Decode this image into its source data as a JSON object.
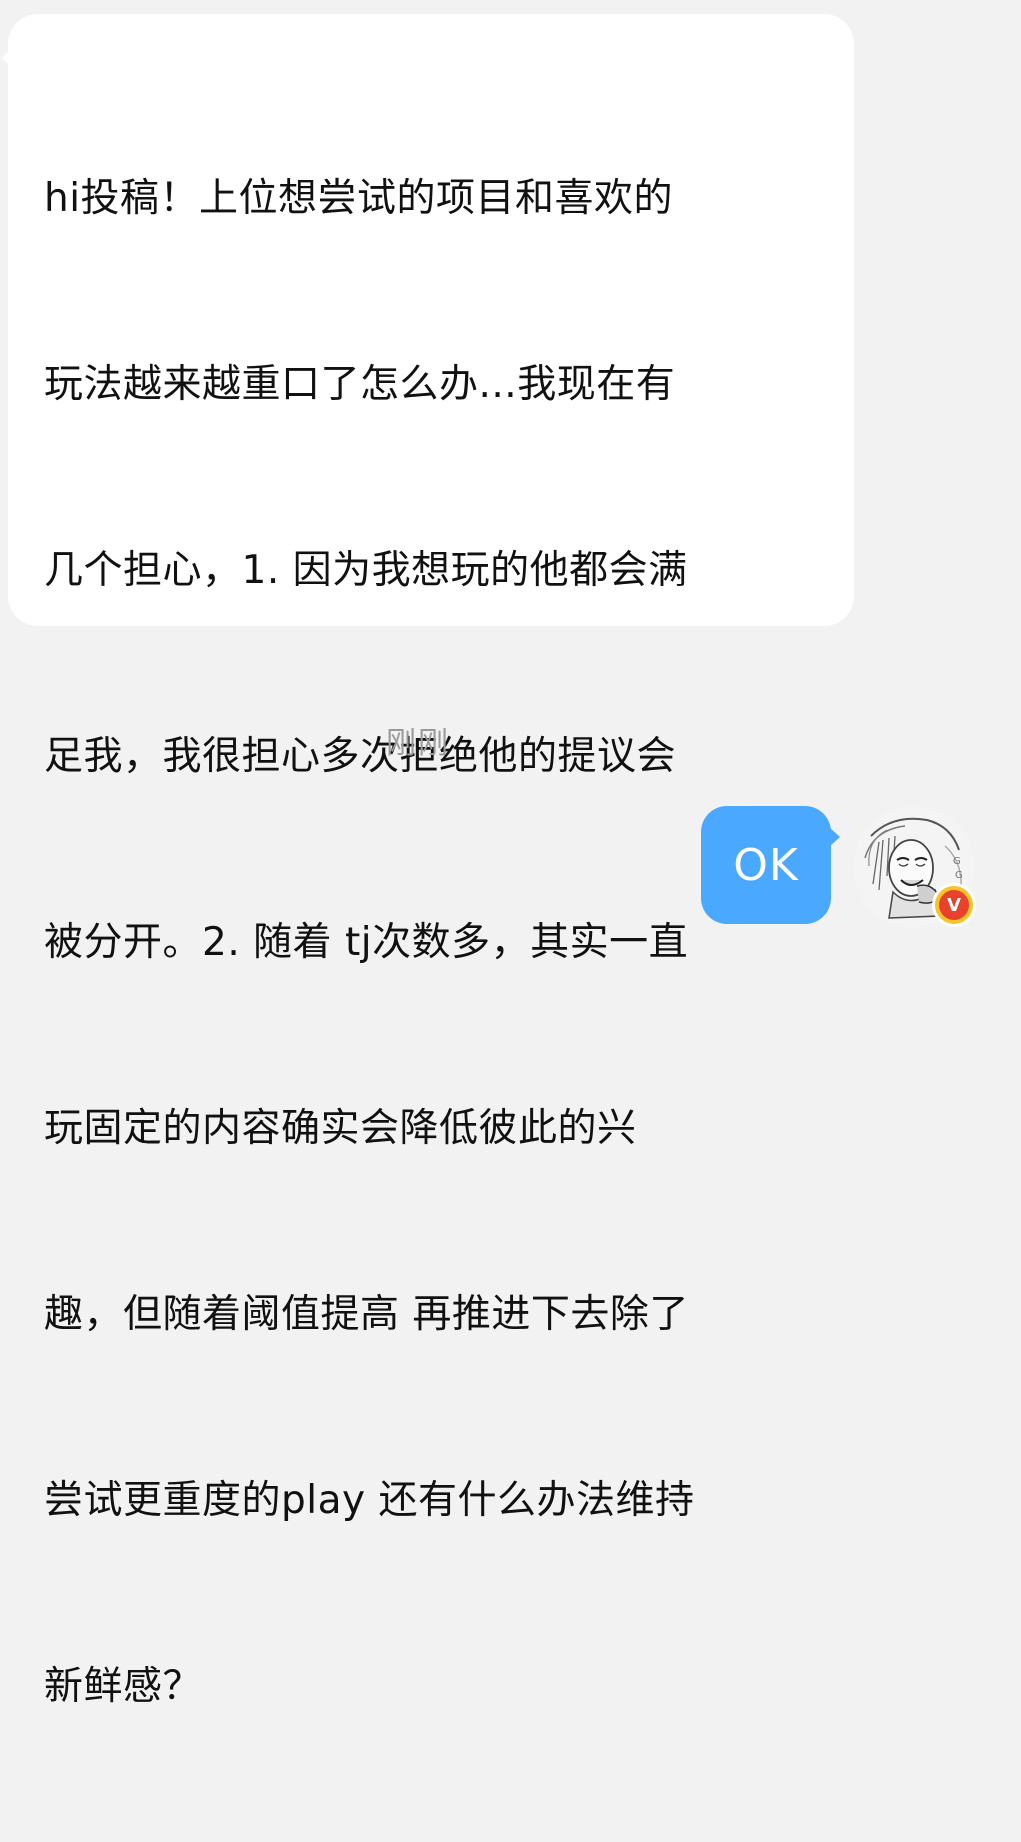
{
  "messages": {
    "incoming": {
      "lines": [
        "hi投稿！上位想尝试的项目和喜欢的",
        "玩法越来越重口了怎么办...我现在有",
        "几个担心，1. 因为我想玩的他都会满",
        "足我，我很担心多次拒绝他的提议会",
        "被分开。2. 随着 tj次数多，其实一直",
        "玩固定的内容确实会降低彼此的兴",
        "趣，但随着阈值提高 再推进下去除了",
        "尝试更重度的play 还有什么办法维持",
        "新鲜感？"
      ]
    },
    "timestamp": "刚刚",
    "outgoing": {
      "text": "OK"
    }
  },
  "avatar": {
    "icon": "user-avatar-manga",
    "badge_icon": "verified-v-badge",
    "badge_text": "V",
    "badge_color": "#f7c52b",
    "badge_inner_color": "#e8412c"
  },
  "colors": {
    "background": "#f2f2f2",
    "incoming_bubble": "#ffffff",
    "outgoing_bubble": "#4aa8ff",
    "timestamp_text": "#9a9a9a"
  }
}
